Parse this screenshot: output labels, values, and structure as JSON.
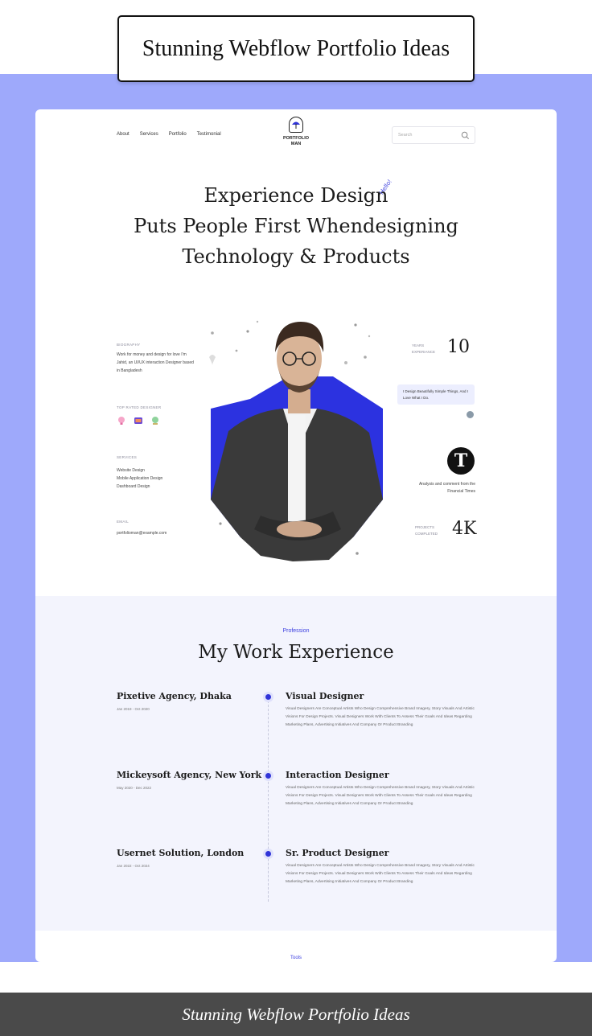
{
  "header_title": "Stunning Webflow Portfolio Ideas",
  "footer_caption": "Stunning Webflow Portfolio Ideas",
  "colors": {
    "band": "#9ea9fb",
    "accent": "#3034d8",
    "section_bg": "#f3f4fd"
  },
  "nav": {
    "links": [
      "About",
      "Services",
      "Portfolio",
      "Testimonial"
    ],
    "logo_line1": "PORTFOLIO",
    "logo_line2": "MAN",
    "search_placeholder": "Search",
    "search_icon": "search-icon"
  },
  "hero": {
    "line1": "Experience Design",
    "line2": "Puts People First Whendesigning",
    "line3": "Technology & Products",
    "hello": "Hello!"
  },
  "left": {
    "biography_label": "BIOGRAPHY",
    "biography_text": "Work for money and design for love I'm Jahid, an UI/UX interaction Designer based in Bangladesh",
    "top_rated_label": "TOP RATED DESIGNER",
    "services_label": "SERVICES",
    "services": [
      "Website Design",
      "Mobile Application Design",
      "Dashboard Design"
    ],
    "email_label": "EMAIL",
    "email": "portfolioman@example.com"
  },
  "right": {
    "years_label_1": "YEARS",
    "years_label_2": "EXPERIANCE",
    "years_value": "10",
    "quote": "I Design Beautifully Simple Things, And I Love What I Do.",
    "nyt_logo": "T",
    "nyt_text": "Analysis and comment from the Financial Times",
    "projects_label_1": "PROJECTS",
    "projects_label_2": "COMPLETED",
    "projects_value": "4K"
  },
  "experience": {
    "tag": "Profession",
    "title": "My Work Experience",
    "items": [
      {
        "company": "Pixetive Agency, Dhaka",
        "dates": "Jan 2019 - Oct 2020",
        "role": "Visual Designer",
        "description": "Visual Designers Are Conceptual Artists Who Design Comprehensive Brand Imagery, Story Visuals And Artistic Visions For Design Projects. Visual Designers Work With Clients To Assess Their Goals And Ideas Regarding Marketing Plans, Advertising Initiatives And Company Or Product Branding"
      },
      {
        "company": "Mickeysoft Agency, New York",
        "dates": "May 2020 - Dec 2022",
        "role": "Interaction Designer",
        "description": "Visual Designers Are Conceptual Artists Who Design Comprehensive Brand Imagery, Story Visuals And Artistic Visions For Design Projects. Visual Designers Work With Clients To Assess Their Goals And Ideas Regarding Marketing Plans, Advertising Initiatives And Company Or Product Branding"
      },
      {
        "company": "Usernet Solution, London",
        "dates": "Jan 2022 - Oct 2024",
        "role": "Sr. Product Designer",
        "description": "Visual Designers Are Conceptual Artists Who Design Comprehensive Brand Imagery, Story Visuals And Artistic Visions For Design Projects. Visual Designers Work With Clients To Assess Their Goals And Ideas Regarding Marketing Plans, Advertising Initiatives And Company Or Product Branding"
      }
    ]
  },
  "next_section_tag": "Tools"
}
